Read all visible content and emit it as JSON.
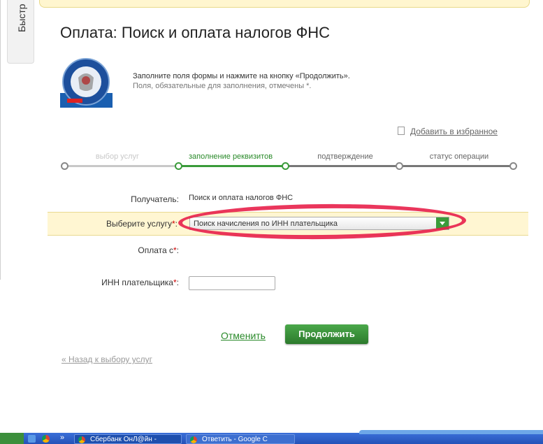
{
  "sidebar": {
    "tab_label": "Быстр"
  },
  "page": {
    "title": "Оплата: Поиск и оплата налогов ФНС",
    "instructions": "Заполните поля формы и нажмите на кнопку «Продолжить».",
    "required_note": "Поля, обязательные для заполнения, отмечены *.",
    "add_favorite": "Добавить в избранное"
  },
  "steps": [
    {
      "label": "выбор услуг",
      "state": "done"
    },
    {
      "label": "заполнение реквизитов",
      "state": "active"
    },
    {
      "label": "подтверждение",
      "state": "pending"
    },
    {
      "label": "статус операции",
      "state": "pending"
    }
  ],
  "form": {
    "recipient_label": "Получатель:",
    "recipient_value": "Поиск и оплата налогов ФНС",
    "service_label": "Выберите услугу",
    "service_selected": "Поиск начисления по ИНН плательщика",
    "pay_from_label": "Оплата с",
    "inn_label": "ИНН плательщика",
    "inn_value": "",
    "required_mark": "*",
    "colon": ":"
  },
  "actions": {
    "cancel": "Отменить",
    "continue": "Продолжить",
    "back": "« Назад к выбору услуг"
  },
  "taskbar": {
    "tasks": [
      {
        "label": "Сбербанк ОнЛ@йн -"
      },
      {
        "label": "Ответить - Google C"
      }
    ],
    "quicklaunch_more": "»"
  },
  "colors": {
    "accent_green": "#3a9b3a",
    "highlight_row": "#fff6d2",
    "annotation_red": "#e8204a"
  }
}
